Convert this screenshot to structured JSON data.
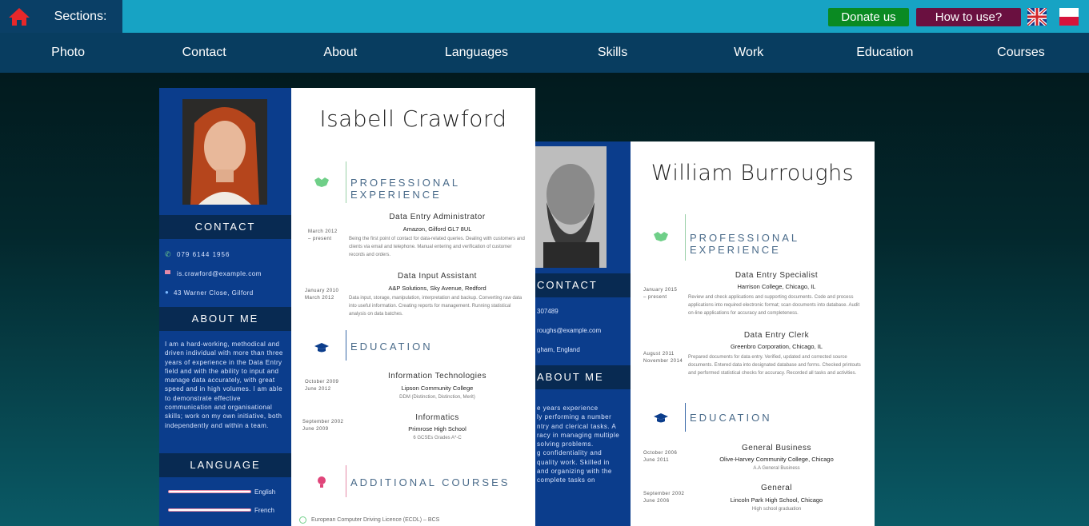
{
  "header": {
    "sections_label": "Sections:",
    "donate_label": "Donate us",
    "howto_label": "How to use?"
  },
  "nav": {
    "items": [
      "Photo",
      "Contact",
      "About",
      "Languages",
      "Skills",
      "Work",
      "Education",
      "Courses"
    ]
  },
  "cv1": {
    "name": "Isabell Crawford",
    "contact_heading": "CONTACT",
    "phone": "079 6144 1956",
    "email": "is.crawford@example.com",
    "address": "43 Warner Close, Gilford",
    "about_heading": "ABOUT ME",
    "about_text": "I am a hard-working, methodical and driven individual with more than three years of experience in the Data Entry field and with the ability to input and manage data accurately, with great speed and in high volumes. I am able to demonstrate effective communication and organisational skills; work on my own initiative, both independently and within a team.",
    "language_heading": "LANGUAGE",
    "languages": [
      "English",
      "French"
    ],
    "experience_heading": "PROFESSIONAL EXPERIENCE",
    "jobs": [
      {
        "title": "Data Entry Administrator",
        "company": "Amazon, Gilford GL7 8UL",
        "date": "March 2012\n– present",
        "desc": "Being the first point of contact for data-related queries. Dealing with customers and clients via email and telephone. Manual entering and verification of customer records and orders."
      },
      {
        "title": "Data Input Assistant",
        "company": "A&P Solutions, Sky Avenue, Redford",
        "date": "January 2010\nMarch 2012",
        "desc": "Data input, storage, manipulation, interpretation and backup. Converting raw data into useful information. Creating reports for management. Running statistical analysis on data batches."
      }
    ],
    "education_heading": "EDUCATION",
    "education": [
      {
        "title": "Information Technologies",
        "school": "Lipson Community College",
        "grade": "DDM (Distinction, Distinction, Merit)",
        "date": "October 2009\nJune 2012"
      },
      {
        "title": "Informatics",
        "school": "Primrose High School",
        "grade": "6 GCSEs Grades A*-C",
        "date": "September 2002\nJune 2009"
      }
    ],
    "courses_heading": "ADDITIONAL COURSES",
    "course_1": "European Computer Driving Licence (ECDL) – BCS"
  },
  "cv2": {
    "name": "William Burroughs",
    "contact_heading": "CONTACT",
    "phone": "307489",
    "email": "roughs@example.com",
    "address": "gham, England",
    "about_heading": "ABOUT ME",
    "about_text": "e years experience\nly performing a number\nntry and clerical tasks. A\nracy in managing multiple\nsolving problems.\ng confidentiality and\nquality work. Skilled in\nand organizing with the\ncomplete tasks on",
    "experience_heading": "PROFESSIONAL EXPERIENCE",
    "jobs": [
      {
        "title": "Data Entry Specialist",
        "company": "Harrison College, Chicago, IL",
        "date": "January 2015\n– present",
        "desc": "Review and check applications and supporting documents. Code and process applications into required electronic format; scan documents into database. Audit on-line applications for accuracy and completeness."
      },
      {
        "title": "Data Entry Clerk",
        "company": "Greenbro Corporation, Chicago, IL",
        "date": "August 2011\nNovember 2014",
        "desc": "Prepared documents for data entry. Verified, updated and corrected source documents. Entered data into designated database and forms. Checked printouts and performed statistical checks for accuracy. Recorded all tasks and activities."
      }
    ],
    "education_heading": "EDUCATION",
    "education": [
      {
        "title": "General Business",
        "school": "Olive-Harvey Community College, Chicago",
        "grade": "A.A General Business",
        "date": "October 2006\nJune 2011"
      },
      {
        "title": "General",
        "school": "Lincoln Park High School, Chicago",
        "grade": "High school graduation",
        "date": "September 2002\nJune 2006"
      }
    ]
  },
  "colors": {
    "topbar": "#17a3c4",
    "nav": "#083d60",
    "donate": "#0a8a22",
    "howto": "#6a1040",
    "cv_sidebar": "#0b3d8c"
  }
}
